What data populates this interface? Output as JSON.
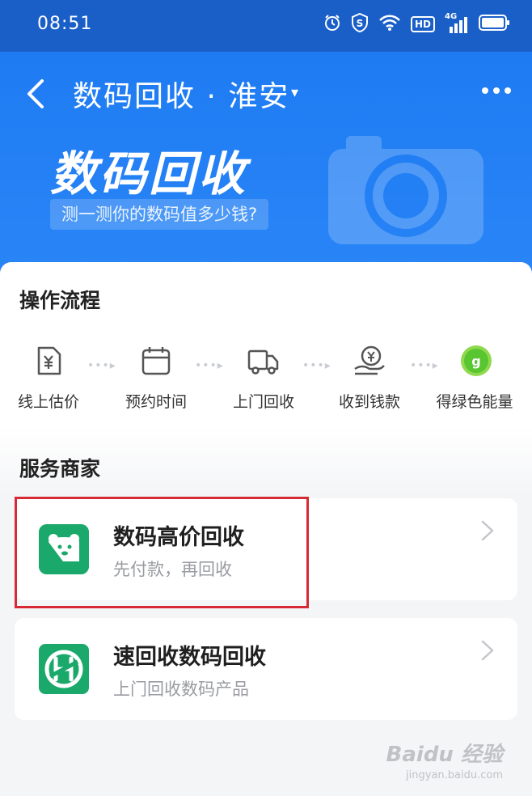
{
  "status_bar": {
    "time": "08:51",
    "icons": [
      "alarm-icon",
      "shield-s-icon",
      "wifi-icon",
      "hd-icon",
      "signal-4g-icon",
      "battery-icon"
    ],
    "hd_label": "HD",
    "network_label": "4G"
  },
  "header": {
    "title": "数码回收 · 淮安",
    "caret": "▾",
    "back_icon": "chevron-left-icon",
    "more_icon": "more-dots-icon",
    "background_color": "#2a86f7"
  },
  "banner": {
    "title": "数码回收",
    "subtitle": "测一测你的数码值多少钱?"
  },
  "process": {
    "title": "操作流程",
    "steps": [
      {
        "label": "线上估价",
        "icon": "yuan-document-icon"
      },
      {
        "label": "预约时间",
        "icon": "calendar-icon"
      },
      {
        "label": "上门回收",
        "icon": "truck-icon"
      },
      {
        "label": "收到钱款",
        "icon": "coin-hand-icon"
      },
      {
        "label": "得绿色能量",
        "icon": "green-energy-icon"
      }
    ],
    "connector": "•••▸"
  },
  "merchants": {
    "title": "服务商家",
    "items": [
      {
        "name": "数码高价回收",
        "desc": "先付款，再回收",
        "logo_icon": "bear-logo-icon",
        "logo_color": "#1aa96a"
      },
      {
        "name": "速回收数码回收",
        "desc": "上门回收数码产品",
        "logo_icon": "sh-logo-icon",
        "logo_color": "#1aa96a"
      }
    ]
  },
  "highlight_color": "#d62a35",
  "watermark": {
    "line1": "Baidu 经验",
    "line2": "jingyan.baidu.com"
  }
}
